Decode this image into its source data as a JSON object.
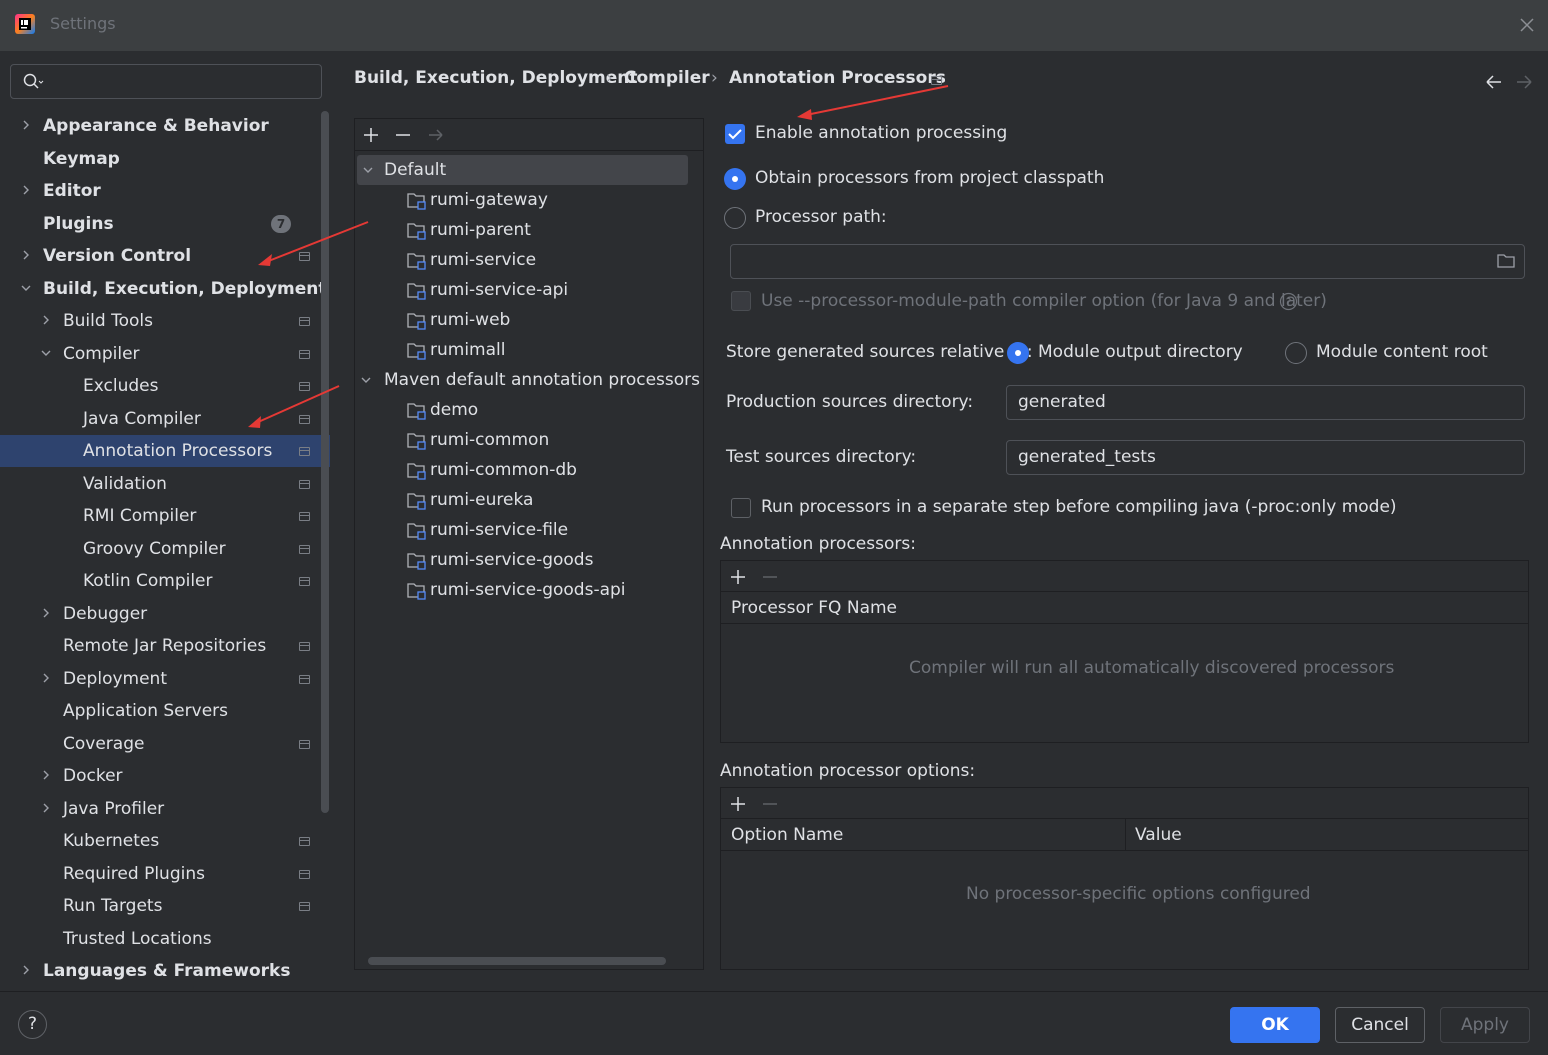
{
  "window": {
    "title": "Settings"
  },
  "search": {
    "placeholder": ""
  },
  "sidebar": {
    "items": [
      {
        "label": "Appearance & Behavior",
        "bold": true,
        "chevron": "right",
        "indent": 0
      },
      {
        "label": "Keymap",
        "bold": true,
        "chevron": "none",
        "indent": 0
      },
      {
        "label": "Editor",
        "bold": true,
        "chevron": "right",
        "indent": 0
      },
      {
        "label": "Plugins",
        "bold": true,
        "chevron": "none",
        "indent": 0,
        "badge": "7"
      },
      {
        "label": "Version Control",
        "bold": true,
        "chevron": "right",
        "indent": 0,
        "project_icon": true
      },
      {
        "label": "Build, Execution, Deployment",
        "bold": true,
        "chevron": "down",
        "indent": 0
      },
      {
        "label": "Build Tools",
        "chevron": "right",
        "indent": 1,
        "project_icon": true
      },
      {
        "label": "Compiler",
        "chevron": "down",
        "indent": 1,
        "project_icon": true
      },
      {
        "label": "Excludes",
        "chevron": "none",
        "indent": 2,
        "project_icon": true
      },
      {
        "label": "Java Compiler",
        "chevron": "none",
        "indent": 2,
        "project_icon": true
      },
      {
        "label": "Annotation Processors",
        "chevron": "none",
        "indent": 2,
        "project_icon": true,
        "selected": true
      },
      {
        "label": "Validation",
        "chevron": "none",
        "indent": 2,
        "project_icon": true
      },
      {
        "label": "RMI Compiler",
        "chevron": "none",
        "indent": 2,
        "project_icon": true
      },
      {
        "label": "Groovy Compiler",
        "chevron": "none",
        "indent": 2,
        "project_icon": true
      },
      {
        "label": "Kotlin Compiler",
        "chevron": "none",
        "indent": 2,
        "project_icon": true
      },
      {
        "label": "Debugger",
        "chevron": "right",
        "indent": 1
      },
      {
        "label": "Remote Jar Repositories",
        "chevron": "none",
        "indent": 1,
        "project_icon": true
      },
      {
        "label": "Deployment",
        "chevron": "right",
        "indent": 1,
        "project_icon": true
      },
      {
        "label": "Application Servers",
        "chevron": "none",
        "indent": 1
      },
      {
        "label": "Coverage",
        "chevron": "none",
        "indent": 1,
        "project_icon": true
      },
      {
        "label": "Docker",
        "chevron": "right",
        "indent": 1
      },
      {
        "label": "Java Profiler",
        "chevron": "right",
        "indent": 1
      },
      {
        "label": "Kubernetes",
        "chevron": "none",
        "indent": 1,
        "project_icon": true
      },
      {
        "label": "Required Plugins",
        "chevron": "none",
        "indent": 1,
        "project_icon": true
      },
      {
        "label": "Run Targets",
        "chevron": "none",
        "indent": 1,
        "project_icon": true
      },
      {
        "label": "Trusted Locations",
        "chevron": "none",
        "indent": 1
      },
      {
        "label": "Languages & Frameworks",
        "bold": true,
        "chevron": "right",
        "indent": 0
      }
    ]
  },
  "breadcrumb": {
    "items": [
      "Build, Execution, Deployment",
      "Compiler",
      "Annotation Processors"
    ],
    "separator": "›"
  },
  "profiles_tree": {
    "groups": [
      {
        "label": "Default",
        "expanded": true,
        "selected": true,
        "modules": [
          "rumi-gateway",
          "rumi-parent",
          "rumi-service",
          "rumi-service-api",
          "rumi-web",
          "rumimall"
        ]
      },
      {
        "label": "Maven default annotation processors pro",
        "expanded": true,
        "modules": [
          "demo",
          "rumi-common",
          "rumi-common-db",
          "rumi-eureka",
          "rumi-service-file",
          "rumi-service-goods",
          "rumi-service-goods-api"
        ]
      }
    ]
  },
  "settings": {
    "enable_processing": {
      "label": "Enable annotation processing",
      "checked": true
    },
    "obtain_classpath": {
      "label": "Obtain processors from project classpath",
      "selected": true
    },
    "processor_path": {
      "label": "Processor path:",
      "selected": false,
      "value": ""
    },
    "module_path_option": {
      "label": "Use --processor-module-path compiler option (for Java 9 and later)",
      "checked": false,
      "enabled": false
    },
    "store_relative": {
      "label": "Store generated sources relative to:",
      "option_output": "Module output directory",
      "option_content": "Module content root",
      "selected": "output"
    },
    "production_dir": {
      "label": "Production sources directory:",
      "value": "generated"
    },
    "test_dir": {
      "label": "Test sources directory:",
      "value": "generated_tests"
    },
    "separate_step": {
      "label": "Run processors in a separate step before compiling java (-proc:only mode)",
      "checked": false
    }
  },
  "processors_table": {
    "title": "Annotation processors:",
    "columns": [
      "Processor FQ Name"
    ],
    "empty_text": "Compiler will run all automatically discovered processors"
  },
  "options_table": {
    "title": "Annotation processor options:",
    "columns": [
      "Option Name",
      "Value"
    ],
    "empty_text": "No processor-specific options configured"
  },
  "buttons": {
    "help": "?",
    "ok": "OK",
    "cancel": "Cancel",
    "apply": "Apply"
  },
  "colors": {
    "accent": "#3574f0",
    "background": "#2b2d30",
    "selection": "#2e436e",
    "annotation_arrow": "#e53935"
  }
}
